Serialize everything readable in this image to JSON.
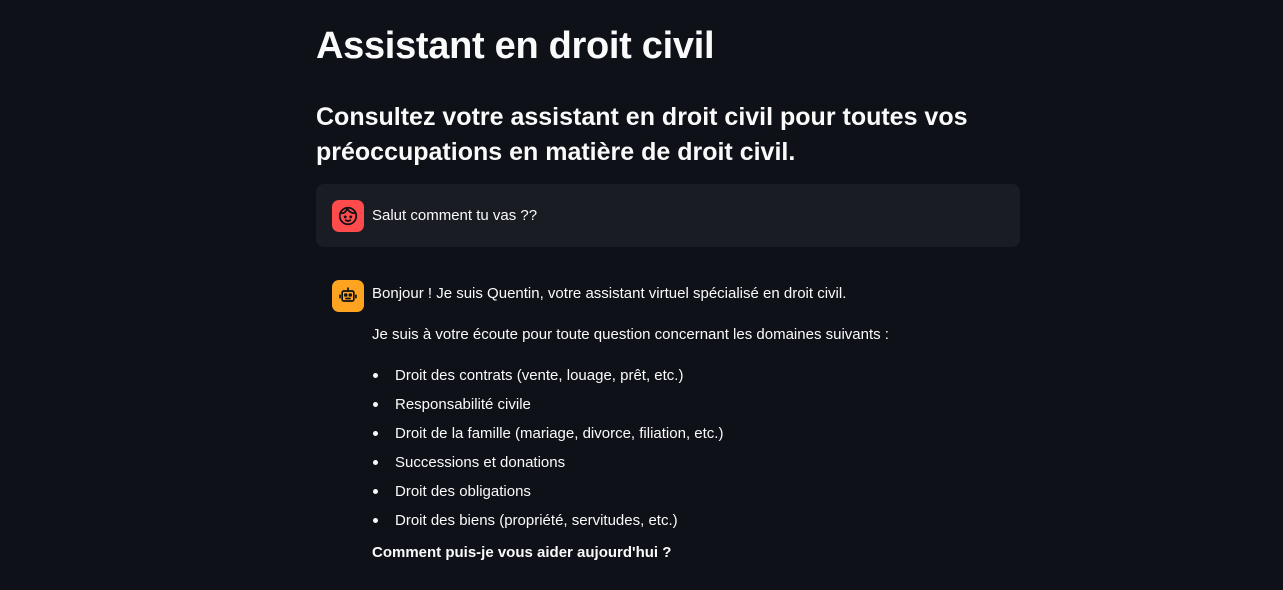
{
  "page": {
    "title": "Assistant en droit civil",
    "subtitle": "Consultez votre assistant en droit civil pour toutes vos préoccupations en matière de droit civil."
  },
  "chat": {
    "user_message": {
      "avatar_icon": "user-face-icon",
      "avatar_color": "#ff4b4b",
      "text": "Salut comment tu vas ??"
    },
    "assistant_message": {
      "avatar_icon": "robot-icon",
      "avatar_color": "#ffa421",
      "intro": "Bonjour ! Je suis Quentin, votre assistant virtuel spécialisé en droit civil.",
      "listen": "Je suis à votre écoute pour toute question concernant les domaines suivants :",
      "domains": [
        "Droit des contrats (vente, louage, prêt, etc.)",
        "Responsabilité civile",
        "Droit de la famille (mariage, divorce, filiation, etc.)",
        "Successions et donations",
        "Droit des obligations",
        "Droit des biens (propriété, servitudes, etc.)"
      ],
      "closing": "Comment puis-je vous aider aujourd'hui ?"
    }
  },
  "theme": {
    "background": "#0e1117",
    "user_bubble": "#1a1c24",
    "text": "#fafafa"
  }
}
